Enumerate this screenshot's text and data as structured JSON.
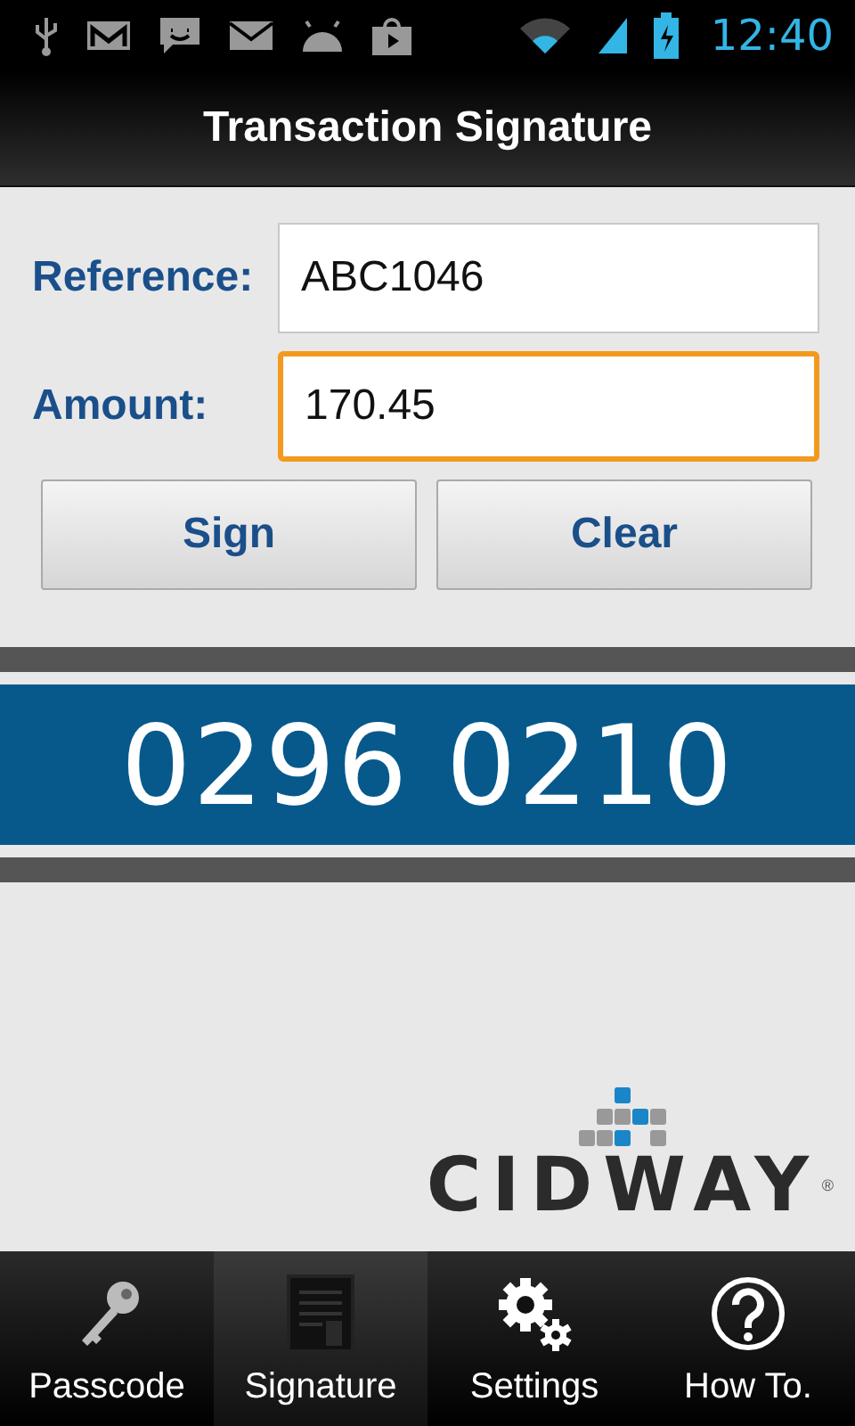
{
  "status_bar": {
    "time": "12:40",
    "battery_charging": true
  },
  "title": "Transaction Signature",
  "fields": [
    {
      "label": "Reference:",
      "value": "ABC1046",
      "focused": false
    },
    {
      "label": "Amount:",
      "value": "170.45",
      "focused": true
    }
  ],
  "buttons": [
    "Sign",
    "Clear"
  ],
  "code": "0296 0210",
  "logo": {
    "text": "CIDWAY",
    "mark": "®"
  },
  "tabs": [
    {
      "kind": "key",
      "label": "Passcode",
      "selected": false
    },
    {
      "kind": "document",
      "label": "Signature",
      "selected": true
    },
    {
      "kind": "gears",
      "label": "Settings",
      "selected": false
    },
    {
      "kind": "help",
      "label": "How To.",
      "selected": false
    }
  ]
}
